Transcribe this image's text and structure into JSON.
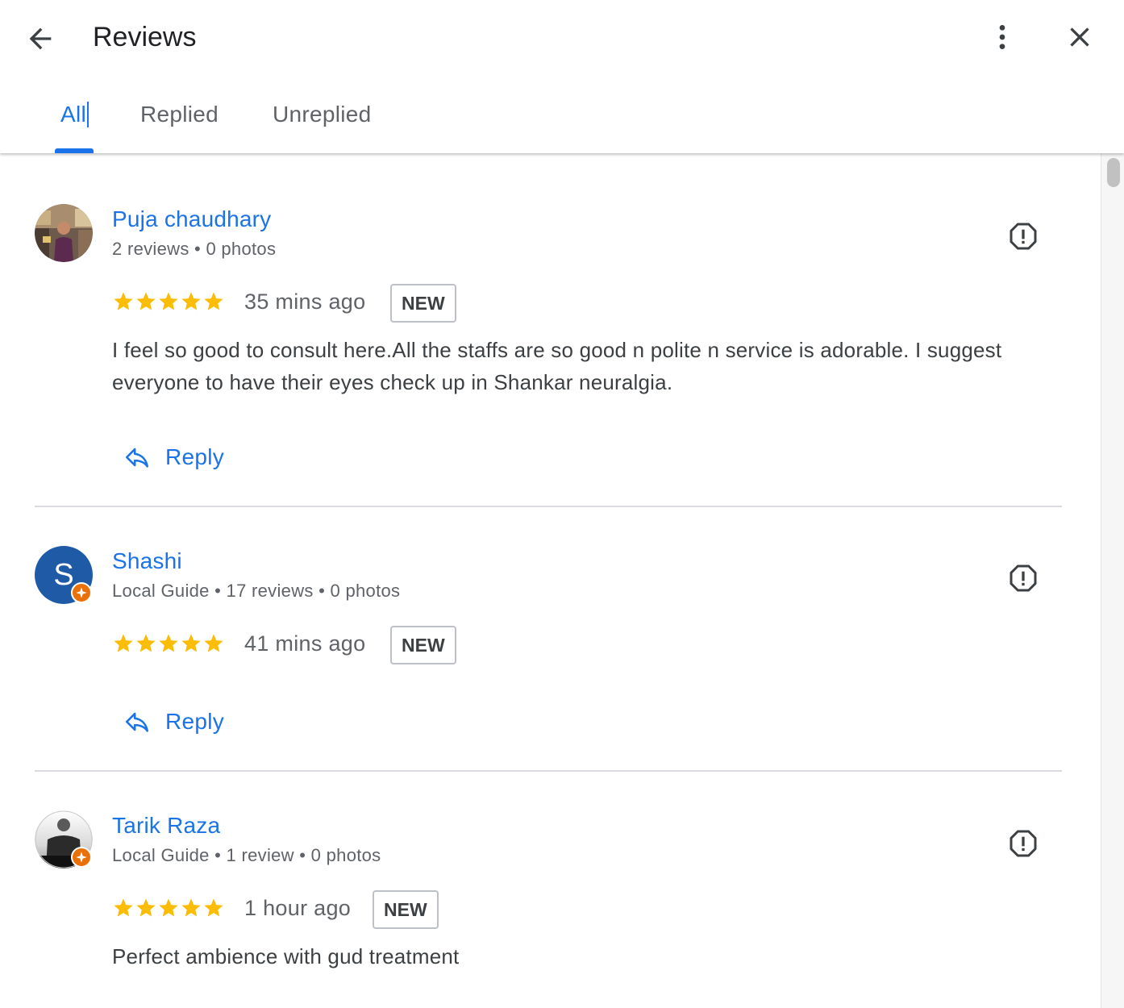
{
  "header": {
    "title": "Reviews",
    "back_icon": "arrow-back-icon",
    "more_icon": "more-vert-icon",
    "close_icon": "close-icon"
  },
  "tabs": [
    {
      "label": "All",
      "active": true
    },
    {
      "label": "Replied",
      "active": false
    },
    {
      "label": "Unreplied",
      "active": false
    }
  ],
  "colors": {
    "accent": "#1a73e8",
    "star": "#fbbc04",
    "local_guide_badge": "#e8710a",
    "avatar_s_bg": "#1f5aa6"
  },
  "reviews": [
    {
      "name": "Puja chaudhary",
      "meta": "2 reviews • 0 photos",
      "rating": 5,
      "time": "35 mins ago",
      "badge": "NEW",
      "text": "I feel so good to consult here.All the staffs are so good n polite n service is adorable. I suggest everyone to have their eyes check up in Shankar neuralgia.",
      "reply_label": "Reply",
      "avatar": "photo-avatar",
      "local_guide": false
    },
    {
      "name": "Shashi",
      "meta": "Local Guide • 17 reviews • 0 photos",
      "rating": 5,
      "time": "41 mins ago",
      "badge": "NEW",
      "text": "",
      "reply_label": "Reply",
      "avatar_letter": "S",
      "local_guide": true
    },
    {
      "name": "Tarik Raza",
      "meta": "Local Guide • 1 review • 0 photos",
      "rating": 5,
      "time": "1 hour ago",
      "badge": "NEW",
      "text": "Perfect ambience with gud treatment",
      "avatar": "photo-avatar",
      "local_guide": true
    }
  ]
}
